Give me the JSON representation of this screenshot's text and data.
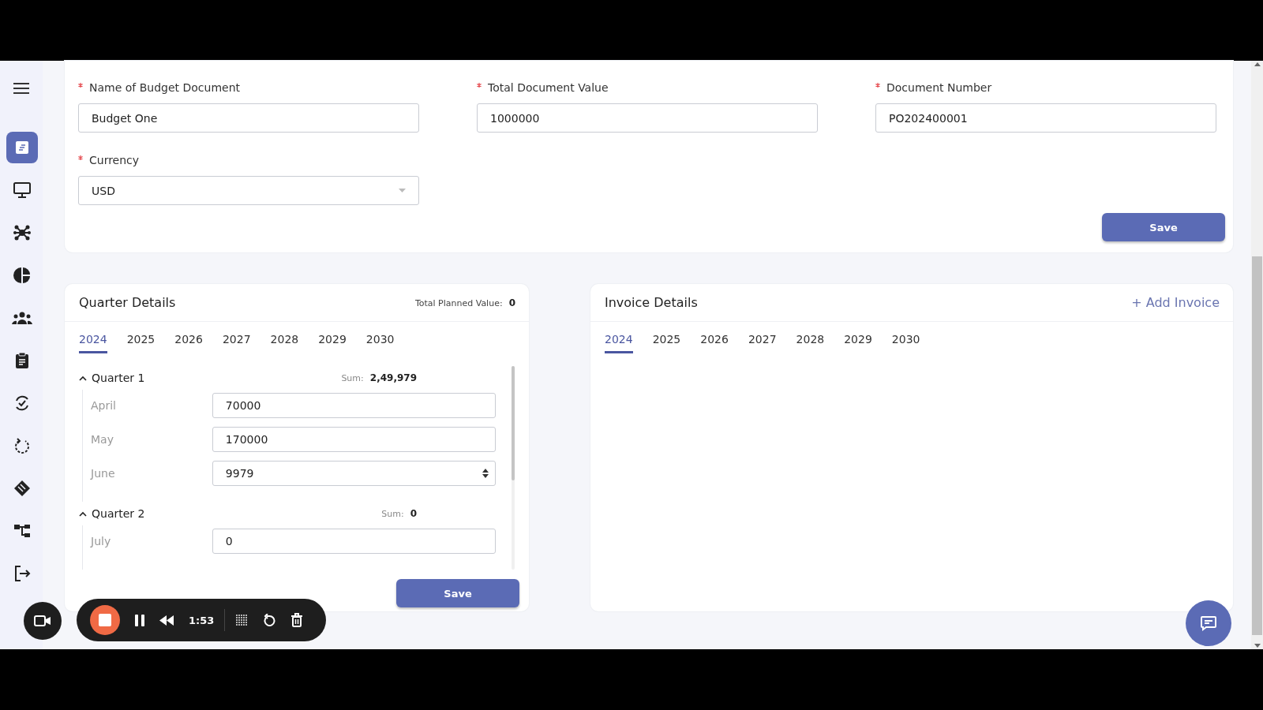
{
  "sidebar": {
    "items": [
      {
        "selected": true
      },
      {
        "selected": false
      },
      {
        "selected": false
      },
      {
        "selected": false
      },
      {
        "selected": false
      },
      {
        "selected": false
      },
      {
        "selected": false
      },
      {
        "selected": false
      },
      {
        "selected": false
      },
      {
        "selected": false
      },
      {
        "selected": false
      }
    ]
  },
  "document_form": {
    "fields": [
      {
        "label": "Name of Budget Document",
        "value": "Budget One",
        "required": true,
        "kind": "text"
      },
      {
        "label": "Total Document Value",
        "value": "1000000",
        "required": true,
        "kind": "text"
      },
      {
        "label": "Document Number",
        "value": "PO202400001",
        "required": true,
        "kind": "text"
      },
      {
        "label": "Currency",
        "value": "USD",
        "required": true,
        "kind": "select"
      }
    ],
    "save_button": "Save"
  },
  "quarter_details": {
    "title": "Quarter Details",
    "total_label": "Total Planned Value:",
    "total_value": "0",
    "years": [
      {
        "label": "2024",
        "selected": true
      },
      {
        "label": "2025",
        "selected": false
      },
      {
        "label": "2026",
        "selected": false
      },
      {
        "label": "2027",
        "selected": false
      },
      {
        "label": "2028",
        "selected": false
      },
      {
        "label": "2029",
        "selected": false
      },
      {
        "label": "2030",
        "selected": false
      }
    ],
    "quarters": [
      {
        "title": "Quarter 1",
        "expanded": true,
        "sum_label": "Sum:",
        "sum_value": "2,49,979",
        "months": [
          {
            "label": "April",
            "value": "70000",
            "spinner": false
          },
          {
            "label": "May",
            "value": "170000",
            "spinner": false
          },
          {
            "label": "June",
            "value": "9979",
            "spinner": true
          }
        ]
      },
      {
        "title": "Quarter 2",
        "expanded": true,
        "sum_label": "Sum:",
        "sum_value": "0",
        "months": [
          {
            "label": "July",
            "value": "0",
            "spinner": false
          }
        ]
      }
    ],
    "save_button": "Save"
  },
  "invoice_details": {
    "title": "Invoice Details",
    "add_button": "+ Add Invoice",
    "years": [
      {
        "label": "2024",
        "selected": true
      },
      {
        "label": "2025",
        "selected": false
      },
      {
        "label": "2026",
        "selected": false
      },
      {
        "label": "2027",
        "selected": false
      },
      {
        "label": "2028",
        "selected": false
      },
      {
        "label": "2029",
        "selected": false
      },
      {
        "label": "2030",
        "selected": false
      }
    ]
  },
  "recorder": {
    "time": "1:53"
  }
}
